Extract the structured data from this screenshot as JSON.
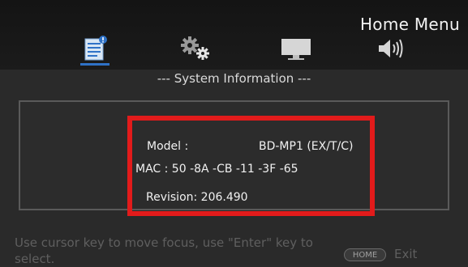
{
  "header": {
    "title": "Home Menu",
    "tabs": [
      {
        "icon": "document-info-icon",
        "selected": true
      },
      {
        "icon": "gears-icon",
        "selected": false
      },
      {
        "icon": "monitor-icon",
        "selected": false
      },
      {
        "icon": "speaker-icon",
        "selected": false
      }
    ]
  },
  "section": {
    "title": "--- System Information ---"
  },
  "info": {
    "model_label": "Model :",
    "model_value": "BD-MP1 (EX/T/C)",
    "mac": "MAC : 50 -8A -CB -11 -3F -65",
    "revision": "Revision:  206.490"
  },
  "footer": {
    "help_text": "Use cursor key to move focus, use \"Enter\" key to select.",
    "home_key": "HOME",
    "exit_label": "Exit"
  },
  "colors": {
    "highlight": "#e21b1b",
    "selected": "#2f72c7",
    "background": "#2a2a2a"
  }
}
